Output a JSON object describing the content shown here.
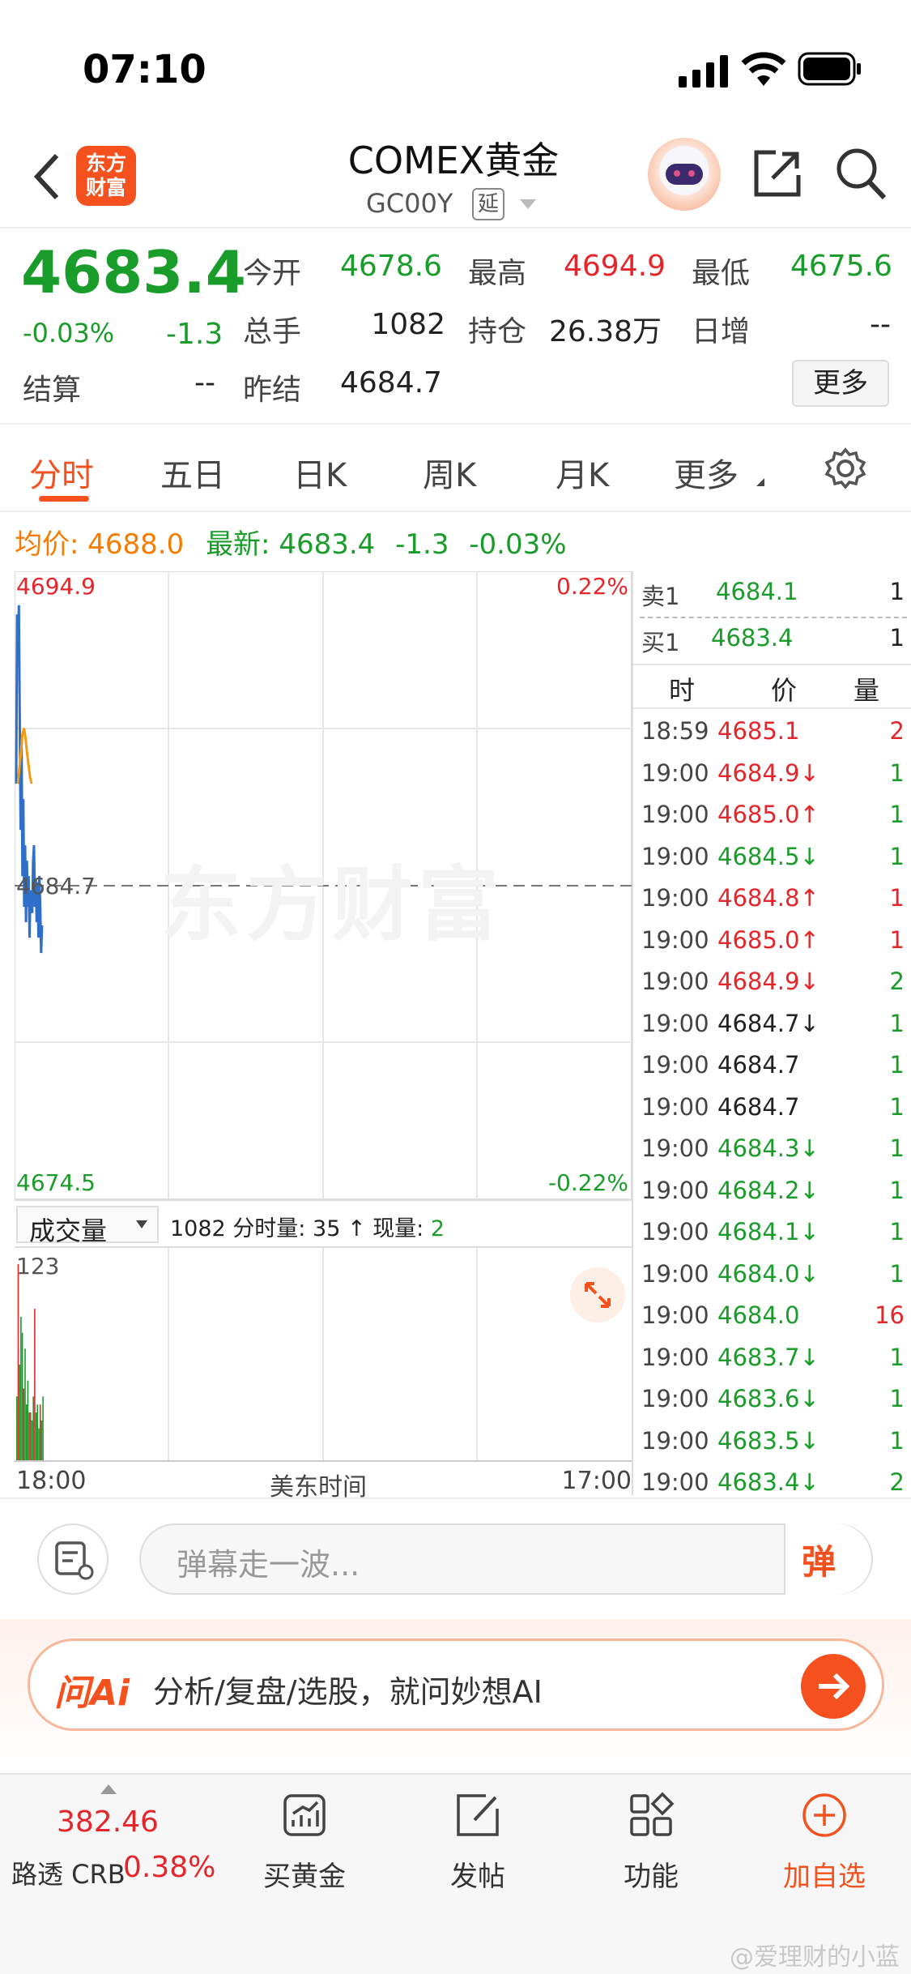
{
  "status_bar": {
    "time": "07:10"
  },
  "header": {
    "logo_text": "东方财富",
    "title": "COMEX黄金",
    "code": "GC00Y",
    "delay_badge": "延"
  },
  "quote": {
    "price": "4683.4",
    "change_pct": "-0.03%",
    "change": "-1.3",
    "settle_label": "结算",
    "settle_value": "--",
    "fields": [
      {
        "label": "今开",
        "value": "4678.6",
        "color": "#1a9c2a"
      },
      {
        "label": "最高",
        "value": "4694.9",
        "color": "#e4262b"
      },
      {
        "label": "最低",
        "value": "4675.6",
        "color": "#1a9c2a"
      },
      {
        "label": "总手",
        "value": "1082",
        "color": "#222222"
      },
      {
        "label": "持仓",
        "value": "26.38万",
        "color": "#222222"
      },
      {
        "label": "日增",
        "value": "--",
        "color": "#222222"
      },
      {
        "label": "昨结",
        "value": "4684.7",
        "color": "#222222"
      }
    ],
    "more_button": "更多"
  },
  "tabs": [
    "分时",
    "五日",
    "日K",
    "周K",
    "月K",
    "更多"
  ],
  "avg_line": {
    "avg_label": "均价:",
    "avg_value": "4688.0",
    "latest_label": "最新:",
    "latest_value": "4683.4",
    "change": "-1.3",
    "change_pct": "-0.03%"
  },
  "chart": {
    "y_high": "4694.9",
    "y_mid": "4684.7",
    "y_low": "4674.5",
    "pct_high": "0.22%",
    "pct_low": "-0.22%",
    "watermark": "东方财富",
    "x_start": "18:00",
    "x_mid": "美东时间",
    "x_end": "17:00"
  },
  "chart_data": {
    "type": "line",
    "ylim": [
      4674.5,
      4694.9
    ],
    "series": [
      {
        "values": [
          4688.0,
          4693.5,
          4692.0,
          4693.8,
          4690.0,
          4686.5,
          4689.5,
          4685.0,
          4687.5,
          4684.0,
          4686.0,
          4683.5,
          4685.5,
          4684.0,
          4685.0,
          4683.0,
          4684.5,
          4684.5,
          4683.8,
          4685.5,
          4686.0,
          4684.0,
          4684.9,
          4683.5,
          4684.8,
          4683.0,
          4685.0,
          4684.0,
          4682.5,
          4683.4
        ]
      },
      {
        "values": [
          4688.0,
          4688.5,
          4689.0,
          4689.6,
          4689.8,
          4689.5,
          4689.0,
          4688.6,
          4688.2,
          4688.0
        ]
      }
    ],
    "volume": [
      40,
      123,
      60,
      90,
      80,
      45,
      70,
      35,
      50,
      30,
      30,
      25,
      40,
      95,
      30,
      35,
      20,
      35,
      25,
      40
    ]
  },
  "trade_list": {
    "sell1_label": "卖1",
    "sell1_price": "4684.1",
    "sell1_vol": "1",
    "buy1_label": "买1",
    "buy1_price": "4683.4",
    "buy1_vol": "1",
    "headers": [
      "时",
      "价",
      "量"
    ],
    "rows": [
      {
        "time": "18:59",
        "price": "4685.1",
        "vol": "2",
        "color": "#e4262b",
        "vcolor": "#e4262b"
      },
      {
        "time": "19:00",
        "price": "4684.9↓",
        "vol": "1",
        "color": "#e4262b",
        "vcolor": "#1a9c2a"
      },
      {
        "time": "19:00",
        "price": "4685.0↑",
        "vol": "1",
        "color": "#e4262b",
        "vcolor": "#1a9c2a"
      },
      {
        "time": "19:00",
        "price": "4684.5↓",
        "vol": "1",
        "color": "#1a9c2a",
        "vcolor": "#1a9c2a"
      },
      {
        "time": "19:00",
        "price": "4684.8↑",
        "vol": "1",
        "color": "#e4262b",
        "vcolor": "#e4262b"
      },
      {
        "time": "19:00",
        "price": "4685.0↑",
        "vol": "1",
        "color": "#e4262b",
        "vcolor": "#e4262b"
      },
      {
        "time": "19:00",
        "price": "4684.9↓",
        "vol": "2",
        "color": "#e4262b",
        "vcolor": "#1a9c2a"
      },
      {
        "time": "19:00",
        "price": "4684.7↓",
        "vol": "1",
        "color": "#222222",
        "vcolor": "#1a9c2a"
      },
      {
        "time": "19:00",
        "price": "4684.7",
        "vol": "1",
        "color": "#222222",
        "vcolor": "#1a9c2a"
      },
      {
        "time": "19:00",
        "price": "4684.7",
        "vol": "1",
        "color": "#222222",
        "vcolor": "#1a9c2a"
      },
      {
        "time": "19:00",
        "price": "4684.3↓",
        "vol": "1",
        "color": "#1a9c2a",
        "vcolor": "#1a9c2a"
      },
      {
        "time": "19:00",
        "price": "4684.2↓",
        "vol": "1",
        "color": "#1a9c2a",
        "vcolor": "#1a9c2a"
      },
      {
        "time": "19:00",
        "price": "4684.1↓",
        "vol": "1",
        "color": "#1a9c2a",
        "vcolor": "#1a9c2a"
      },
      {
        "time": "19:00",
        "price": "4684.0↓",
        "vol": "1",
        "color": "#1a9c2a",
        "vcolor": "#1a9c2a"
      },
      {
        "time": "19:00",
        "price": "4684.0",
        "vol": "16",
        "color": "#1a9c2a",
        "vcolor": "#e4262b"
      },
      {
        "time": "19:00",
        "price": "4683.7↓",
        "vol": "1",
        "color": "#1a9c2a",
        "vcolor": "#1a9c2a"
      },
      {
        "time": "19:00",
        "price": "4683.6↓",
        "vol": "1",
        "color": "#1a9c2a",
        "vcolor": "#1a9c2a"
      },
      {
        "time": "19:00",
        "price": "4683.5↓",
        "vol": "1",
        "color": "#1a9c2a",
        "vcolor": "#1a9c2a"
      },
      {
        "time": "19:00",
        "price": "4683.4↓",
        "vol": "2",
        "color": "#1a9c2a",
        "vcolor": "#1a9c2a"
      }
    ]
  },
  "volume_bar": {
    "selector": "成交量",
    "total": "1082",
    "minute_label": "分时量:",
    "minute_value": "35",
    "arrow": "↑",
    "current_label": "现量:",
    "current_value": "2",
    "max_label": "123"
  },
  "comment": {
    "placeholder": "弹幕走一波...",
    "send_icon_text": "弹"
  },
  "ai_bar": {
    "logo": "问Ai",
    "text": "分析/复盘/选股，就问妙想AI"
  },
  "bottom_bar": {
    "index_value": "382.46",
    "index_name": "路透 CRB",
    "index_change": "0.38%",
    "buy_gold": "买黄金",
    "post": "发帖",
    "functions": "功能",
    "add_favorite": "加自选",
    "watermark": "@爱理财的小蓝"
  }
}
